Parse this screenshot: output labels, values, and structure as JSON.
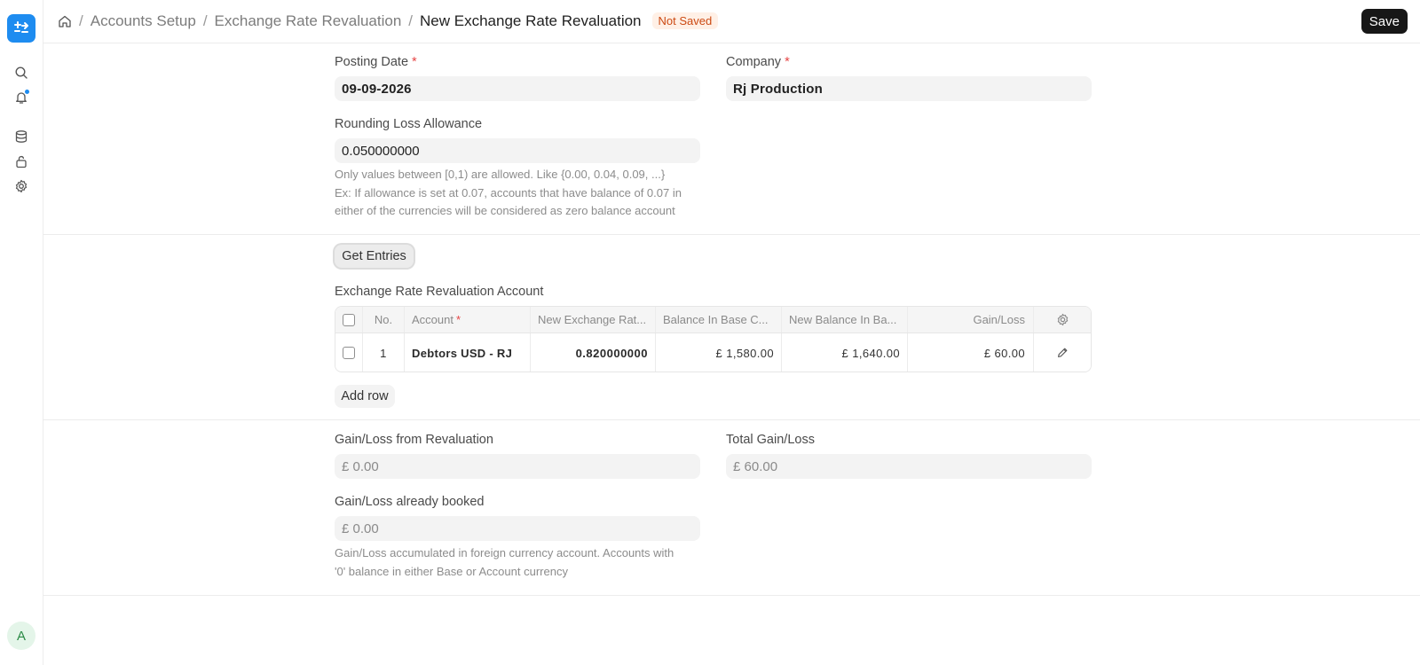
{
  "header": {
    "breadcrumbs": [
      "Accounts Setup",
      "Exchange Rate Revaluation"
    ],
    "title": "New Exchange Rate Revaluation",
    "status": "Not Saved",
    "save_label": "Save"
  },
  "sidebar": {
    "icons": [
      "search-icon",
      "bell-icon",
      "database-icon",
      "lock-icon",
      "gear-icon"
    ],
    "avatar_initial": "A",
    "accent_color": "#1e8cf0"
  },
  "form": {
    "posting_date": {
      "label": "Posting Date",
      "value": "09-09-2026"
    },
    "company": {
      "label": "Company",
      "value": "Rj Production"
    },
    "rounding_loss": {
      "label": "Rounding Loss Allowance",
      "value": "0.050000000",
      "help_lines": [
        "Only values between [0,1) are allowed. Like {0.00, 0.04, 0.09, ...}",
        "Ex: If allowance is set at 0.07, accounts that have balance of 0.07 in",
        "either of the currencies will be considered as zero balance account"
      ]
    },
    "get_entries_label": "Get Entries",
    "table_title": "Exchange Rate Revaluation Account",
    "table": {
      "columns": [
        "No.",
        "Account",
        "New Exchange Rat...",
        "Balance In Base C...",
        "New Balance In Ba...",
        "Gain/Loss"
      ],
      "rows": [
        {
          "no": "1",
          "account": "Debtors USD - RJ",
          "new_rate": "0.820000000",
          "balance_base": "£ 1,580.00",
          "new_balance_base": "£ 1,640.00",
          "gain_loss": "£ 60.00"
        }
      ]
    },
    "add_row_label": "Add row",
    "gain_loss_revaluation": {
      "label": "Gain/Loss from Revaluation",
      "value": "£ 0.00"
    },
    "total_gain_loss": {
      "label": "Total Gain/Loss",
      "value": "£ 60.00"
    },
    "gain_loss_booked": {
      "label": "Gain/Loss already booked",
      "value": "£ 0.00",
      "help_lines": [
        "Gain/Loss accumulated in foreign currency account. Accounts with",
        "'0' balance in either Base or Account currency"
      ]
    }
  }
}
